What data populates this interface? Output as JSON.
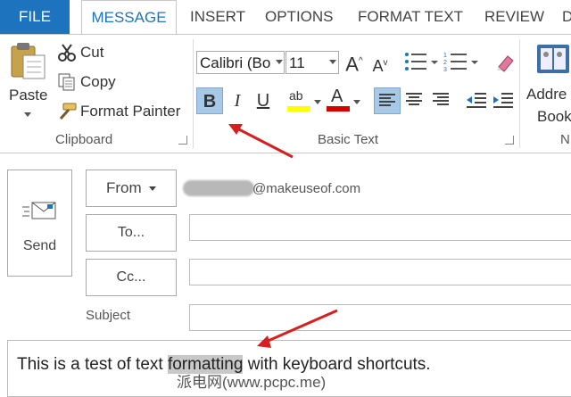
{
  "tabs": {
    "file": "FILE",
    "message": "MESSAGE",
    "insert": "INSERT",
    "options": "OPTIONS",
    "format_text": "FORMAT TEXT",
    "review": "REVIEW",
    "cut_off": "D"
  },
  "clipboard": {
    "paste": "Paste",
    "cut": "Cut",
    "copy": "Copy",
    "format_painter": "Format Painter",
    "group_label": "Clipboard"
  },
  "basic_text": {
    "font_name": "Calibri (Bo",
    "font_size": "11",
    "bold": "B",
    "italic": "I",
    "underline": "U",
    "font_color_glyph": "A",
    "highlight_glyph": "ab",
    "group_label": "Basic Text",
    "bold_active": true,
    "highlight_color": "#ffff00",
    "font_color": "#d40000"
  },
  "names": {
    "address_line1": "Addre",
    "address_line2": "Book",
    "group_label_cut": "N"
  },
  "compose": {
    "send": "Send",
    "from_button": "From",
    "from_value": "@makeuseof.com",
    "to_button": "To...",
    "cc_button": "Cc...",
    "subject_label": "Subject",
    "to_value": "",
    "cc_value": "",
    "subject_value": ""
  },
  "body": {
    "text_before": "This is a test of text ",
    "text_selected": "formatting",
    "text_after": " with keyboard shortcuts."
  },
  "watermark": "派电网(www.pcpc.me)",
  "colors": {
    "accent": "#1e73be",
    "annotation_arrow": "#d62020"
  }
}
